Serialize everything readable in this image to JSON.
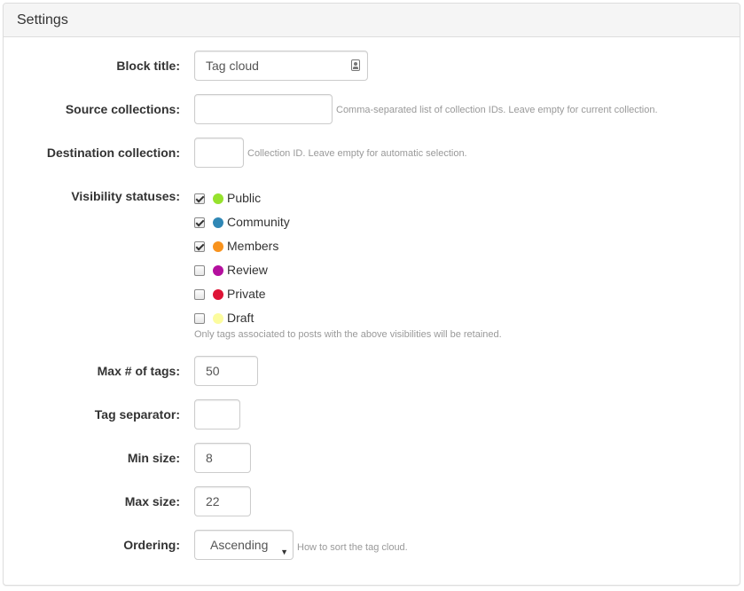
{
  "panel": {
    "title": "Settings"
  },
  "fields": {
    "block_title": {
      "label": "Block title:",
      "value": "Tag cloud"
    },
    "source_collections": {
      "label": "Source collections:",
      "value": "",
      "help": "Comma-separated list of collection IDs. Leave empty for current collection."
    },
    "destination_collection": {
      "label": "Destination collection:",
      "value": "",
      "help": "Collection ID. Leave empty for automatic selection."
    },
    "visibility": {
      "label": "Visibility statuses:",
      "help": "Only tags associated to posts with the above visibilities will be retained.",
      "options": [
        {
          "label": "Public",
          "checked": true,
          "color": "#96e22d"
        },
        {
          "label": "Community",
          "checked": true,
          "color": "#2f87b5"
        },
        {
          "label": "Members",
          "checked": true,
          "color": "#f8931e"
        },
        {
          "label": "Review",
          "checked": false,
          "color": "#b4109e"
        },
        {
          "label": "Private",
          "checked": false,
          "color": "#de1436"
        },
        {
          "label": "Draft",
          "checked": false,
          "color": "#fcfc9e"
        }
      ]
    },
    "max_tags": {
      "label": "Max # of tags:",
      "value": "50"
    },
    "tag_separator": {
      "label": "Tag separator:",
      "value": ""
    },
    "min_size": {
      "label": "Min size:",
      "value": "8"
    },
    "max_size": {
      "label": "Max size:",
      "value": "22"
    },
    "ordering": {
      "label": "Ordering:",
      "value": "Ascending",
      "help": "How to sort the tag cloud."
    }
  }
}
